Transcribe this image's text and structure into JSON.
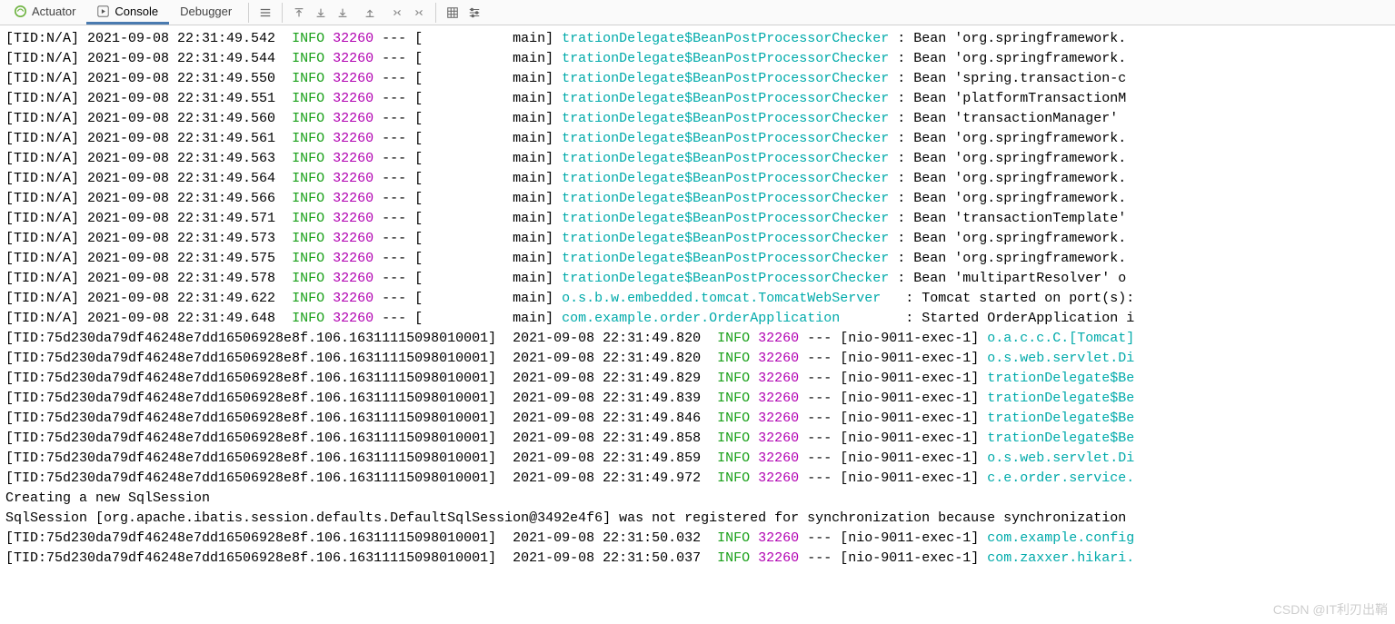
{
  "tabs": {
    "actuator": "Actuator",
    "console": "Console",
    "debugger": "Debugger"
  },
  "watermark": "CSDN @IT利刃出鞘",
  "log": {
    "level": "INFO",
    "pid": "32260",
    "shortTid": "[TID:N/A]",
    "longTid": "[TID:75d230da79df46248e7dd16506928e8f.106.16311115098010001]",
    "mainThread": "main]",
    "nioThread": "[nio-9011-exec-1]",
    "checker": "trationDelegate$BeanPostProcessorChecker",
    "tomcat": "o.s.b.w.embedded.tomcat.TomcatWebServer  ",
    "orderApp": "com.example.order.OrderApplication       ",
    "short1": [
      {
        "ts": "2021-09-08 22:31:49.542",
        "msg": ": Bean 'org.springframework."
      },
      {
        "ts": "2021-09-08 22:31:49.544",
        "msg": ": Bean 'org.springframework."
      },
      {
        "ts": "2021-09-08 22:31:49.550",
        "msg": ": Bean 'spring.transaction-c"
      },
      {
        "ts": "2021-09-08 22:31:49.551",
        "msg": ": Bean 'platformTransactionM"
      },
      {
        "ts": "2021-09-08 22:31:49.560",
        "msg": ": Bean 'transactionManager' "
      },
      {
        "ts": "2021-09-08 22:31:49.561",
        "msg": ": Bean 'org.springframework."
      },
      {
        "ts": "2021-09-08 22:31:49.563",
        "msg": ": Bean 'org.springframework."
      },
      {
        "ts": "2021-09-08 22:31:49.564",
        "msg": ": Bean 'org.springframework."
      },
      {
        "ts": "2021-09-08 22:31:49.566",
        "msg": ": Bean 'org.springframework."
      },
      {
        "ts": "2021-09-08 22:31:49.571",
        "msg": ": Bean 'transactionTemplate'"
      },
      {
        "ts": "2021-09-08 22:31:49.573",
        "msg": ": Bean 'org.springframework."
      },
      {
        "ts": "2021-09-08 22:31:49.575",
        "msg": ": Bean 'org.springframework."
      },
      {
        "ts": "2021-09-08 22:31:49.578",
        "msg": ": Bean 'multipartResolver' o"
      }
    ],
    "tomcatLine": {
      "ts": "2021-09-08 22:31:49.622",
      "msg": ": Tomcat started on port(s):"
    },
    "startedLine": {
      "ts": "2021-09-08 22:31:49.648",
      "msg": ": Started OrderApplication i"
    },
    "long1": [
      {
        "ts": "2021-09-08 22:31:49.820",
        "lg": "o.a.c.c.C.[Tomcat]"
      },
      {
        "ts": "2021-09-08 22:31:49.820",
        "lg": "o.s.web.servlet.Di"
      },
      {
        "ts": "2021-09-08 22:31:49.829",
        "lg": "trationDelegate$Be"
      },
      {
        "ts": "2021-09-08 22:31:49.839",
        "lg": "trationDelegate$Be"
      },
      {
        "ts": "2021-09-08 22:31:49.846",
        "lg": "trationDelegate$Be"
      },
      {
        "ts": "2021-09-08 22:31:49.858",
        "lg": "trationDelegate$Be"
      },
      {
        "ts": "2021-09-08 22:31:49.859",
        "lg": "o.s.web.servlet.Di"
      },
      {
        "ts": "2021-09-08 22:31:49.972",
        "lg": "c.e.order.service."
      }
    ],
    "sqlLine1": "Creating a new SqlSession",
    "sqlLine2": "SqlSession [org.apache.ibatis.session.defaults.DefaultSqlSession@3492e4f6] was not registered for synchronization because synchronization",
    "long2": [
      {
        "ts": "2021-09-08 22:31:50.032",
        "lg": "com.example.config"
      },
      {
        "ts": "2021-09-08 22:31:50.037",
        "lg": "com.zaxxer.hikari."
      }
    ]
  }
}
